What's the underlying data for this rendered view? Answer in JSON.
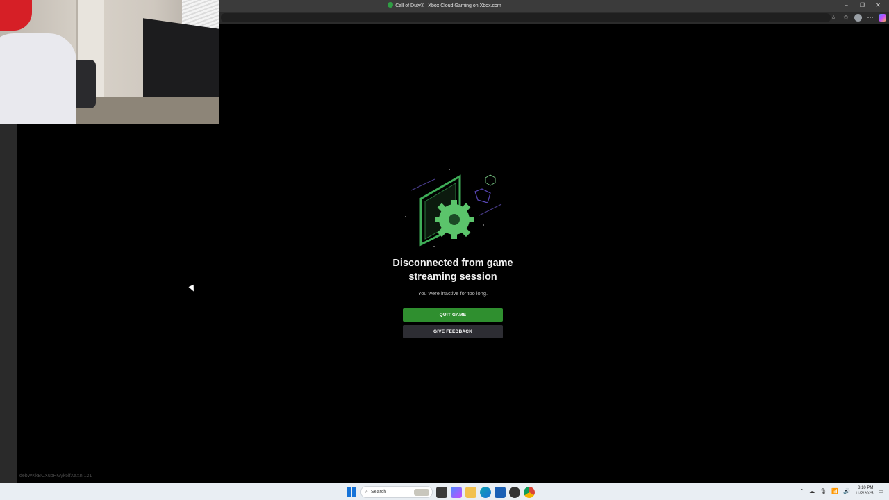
{
  "browser": {
    "title": "Call of Duty® | Xbox Cloud Gaming on Xbox.com",
    "window_controls": [
      "–",
      "❐",
      "✕"
    ]
  },
  "error": {
    "title_line1": "Disconnected from game",
    "title_line2": "streaming session",
    "message": "You were inactive for too long.",
    "quit_label": "QUIT GAME",
    "feedback_label": "GIVE FEEDBACK"
  },
  "session_id": "debWKkBCXubHGyk5lfXaXn.121",
  "taskbar": {
    "search_placeholder": "Search",
    "clock_time": "8:10 PM",
    "clock_date": "11/2/2025"
  },
  "colors": {
    "accent_green": "#2f8f2f",
    "feedback_bg": "#2d2d33",
    "background": "#000000"
  }
}
